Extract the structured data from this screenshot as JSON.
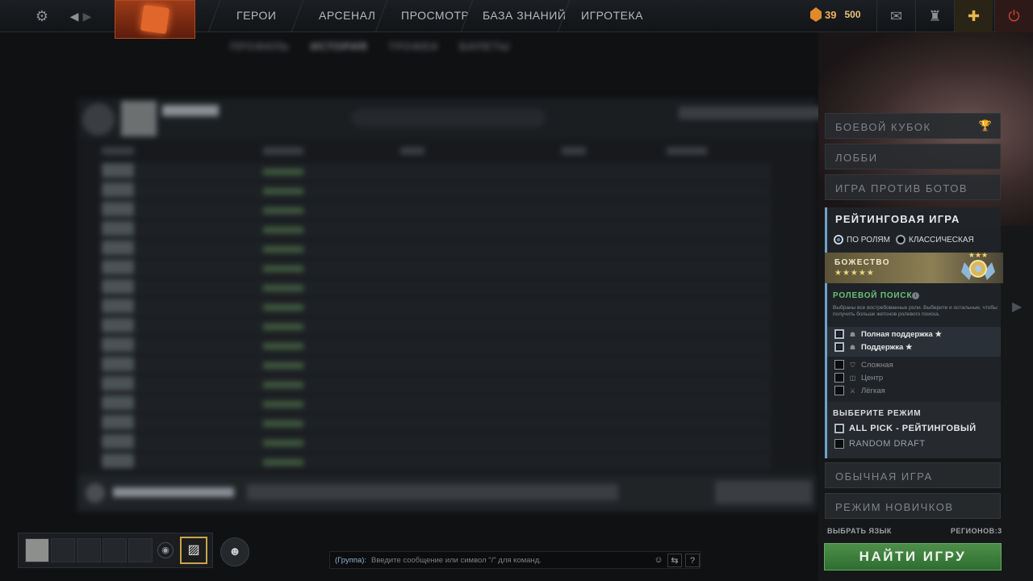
{
  "topbar": {
    "nav": [
      "ГЕРОИ",
      "АРСЕНАЛ",
      "ПРОСМОТР",
      "БАЗА ЗНАНИЙ",
      "ИГРОТЕКА"
    ],
    "currency_value": "39",
    "currency_value2": "500"
  },
  "profile_tabs": [
    "ПРОФИЛЬ",
    "ИСТОРИЯ",
    "ТРОФЕИ",
    "БИЛЕТЫ"
  ],
  "play_menu": {
    "battle_cup": "БОЕВОЙ КУБОК",
    "lobby": "ЛОББИ",
    "vs_bots": "ИГРА ПРОТИВ БОТОВ",
    "ranked": {
      "title": "РЕЙТИНГОВАЯ ИГРА",
      "radio_roles": "ПО РОЛЯМ",
      "radio_classic": "КЛАССИЧЕСКАЯ",
      "medal_name": "БОЖЕСТВО",
      "medal_stars": "★★★★★",
      "role_search_title": "РОЛЕВОЙ ПОИСК",
      "role_search_desc": "Выбраны все востребованные роли. Выберите и остальные, чтобы получить больше жетонов ролевого поиска.",
      "roles": [
        {
          "label": "Полная поддержка ★",
          "checked": true
        },
        {
          "label": "Поддержка ★",
          "checked": true
        },
        {
          "label": "Сложная",
          "checked": false
        },
        {
          "label": "Центр",
          "checked": false
        },
        {
          "label": "Лёгкая",
          "checked": false
        }
      ],
      "mode_title": "ВЫБЕРИТЕ РЕЖИМ",
      "modes": [
        {
          "label": "ALL PICK - РЕЙТИНГОВЫЙ",
          "checked": true
        },
        {
          "label": "RANDOM DRAFT",
          "checked": false
        }
      ]
    },
    "normal": "ОБЫЧНАЯ ИГРА",
    "novice": "РЕЖИМ НОВИЧКОВ",
    "language": "ВЫБРАТЬ ЯЗЫК",
    "regions": "РЕГИОНОВ:3",
    "find_game": "НАЙТИ ИГРУ"
  },
  "chat": {
    "channel": "(Группа):",
    "placeholder": "Введите сообщение или символ \"/\" для команд."
  },
  "colors": {
    "accent_green": "#4d8f4a",
    "ranked_border": "#6fa3c9",
    "gold": "#f0b15a"
  }
}
